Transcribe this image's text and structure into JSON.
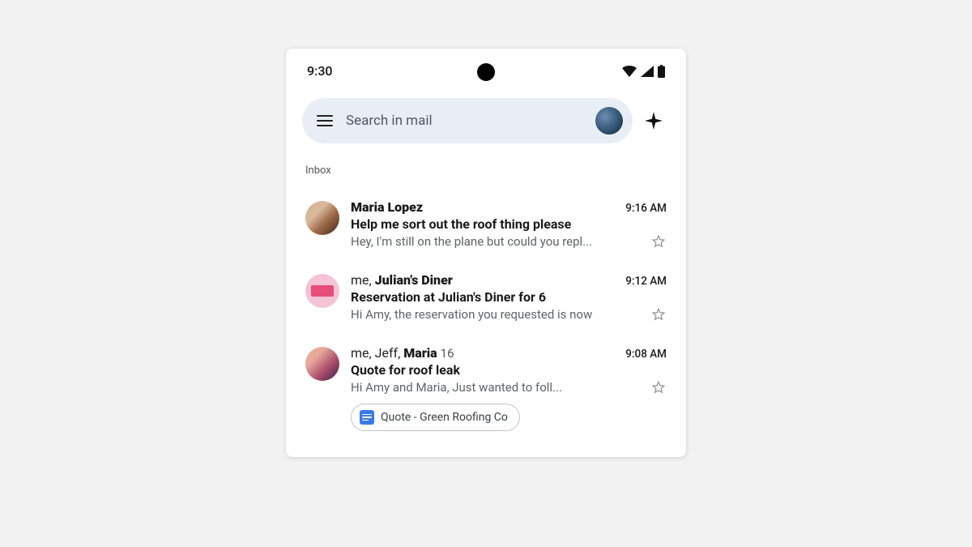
{
  "status_bar": {
    "time": "9:30"
  },
  "search": {
    "placeholder": "Search in mail"
  },
  "section_label": "Inbox",
  "emails": [
    {
      "sender_html": "<b>Maria Lopez</b>",
      "time": "9:16 AM",
      "subject": "Help me sort out the roof thing please",
      "snippet": "Hey, I'm still on the plane but could you repl..."
    },
    {
      "sender_html": "<span class='light'>me, </span><b>Julian's Diner</b>",
      "time": "9:12 AM",
      "subject": "Reservation at Julian's Diner for 6",
      "snippet": "Hi Amy, the reservation you requested is now"
    },
    {
      "sender_html": "<span class='light'>me, Jeff, </span><b>Maria</b><span class='count'>16</span>",
      "time": "9:08 AM",
      "subject": "Quote for roof leak",
      "snippet": "Hi Amy and Maria, Just wanted to foll...",
      "attachment": "Quote - Green Roofing Co"
    }
  ]
}
